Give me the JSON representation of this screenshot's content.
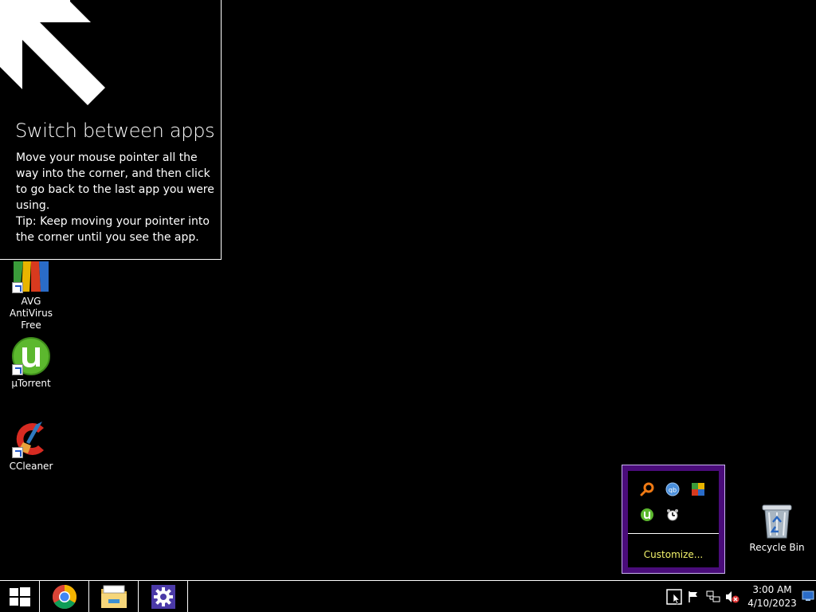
{
  "tip": {
    "title": "Switch between apps",
    "body_line1": "Move your mouse pointer all the way into the corner, and then click to go back to the last app you were using.",
    "body_line2": "Tip: Keep moving your pointer into the corner until you see the app."
  },
  "desktop_icons": [
    {
      "label": "AVG AntiVirus Free"
    },
    {
      "label": "µTorrent"
    },
    {
      "label": "CCleaner"
    },
    {
      "label": "Recycle Bin"
    }
  ],
  "tray_flyout": {
    "customize_label": "Customize...",
    "icons": [
      "search-icon",
      "qbittorrent-icon",
      "avg-icon",
      "utorrent-icon",
      "timer-icon"
    ]
  },
  "taskbar": {
    "pinned": [
      "windows-start",
      "chrome",
      "file-explorer",
      "settings"
    ],
    "clock_time": "3:00 AM",
    "clock_date": "4/10/2023"
  },
  "colors": {
    "background": "#000000",
    "flyout_border": "#4a0c7a",
    "customize_text": "#f3f36b",
    "settings_tile": "#4b3aa8"
  }
}
